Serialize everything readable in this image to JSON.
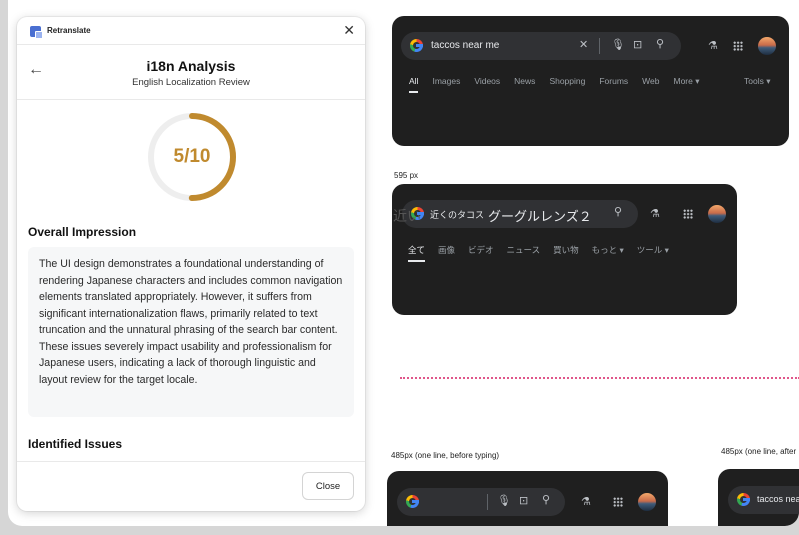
{
  "dialog": {
    "app_name": "Retranslate",
    "title": "i18n Analysis",
    "subtitle": "English Localization Review",
    "score": {
      "text": "5/10",
      "value": 5,
      "max": 10
    },
    "overall_title": "Overall Impression",
    "overall_text": "The UI design demonstrates a foundational understanding of rendering Japanese characters and includes common navigation elements translated appropriately. However, it suffers from significant internationalization flaws, primarily related to text truncation and the unnatural phrasing of the search bar content. These issues severely impact usability and professionalism for Japanese users, indicating a lack of thorough linguistic and layout review for the target locale.",
    "issues_title": "Identified Issues",
    "close_label": "Close",
    "colors": {
      "accent": "#c08a2e",
      "ring_track": "#eeeeee"
    }
  },
  "panel1": {
    "query": "taccos near me",
    "tabs": [
      "All",
      "Images",
      "Videos",
      "News",
      "Shopping",
      "Forums",
      "Web",
      "More ▾"
    ],
    "tools": "Tools ▾"
  },
  "panel2": {
    "label": "595 px",
    "query_overlap": "近い",
    "query_small": "近くのタコス",
    "query_large": "グーグルレンズ２",
    "tabs": [
      "全て",
      "画像",
      "ビデオ",
      "ニュース",
      "買い物",
      "もっと ▾",
      "ツール ▾"
    ]
  },
  "panel3": {
    "label": "485px (one line, before typing)"
  },
  "panel4": {
    "label": "485px (one line, after",
    "query": "taccos nea"
  },
  "colors": {
    "dark_panel": "#1f1f1f",
    "search_bar": "#303134",
    "guide_line": "#e0568a"
  }
}
